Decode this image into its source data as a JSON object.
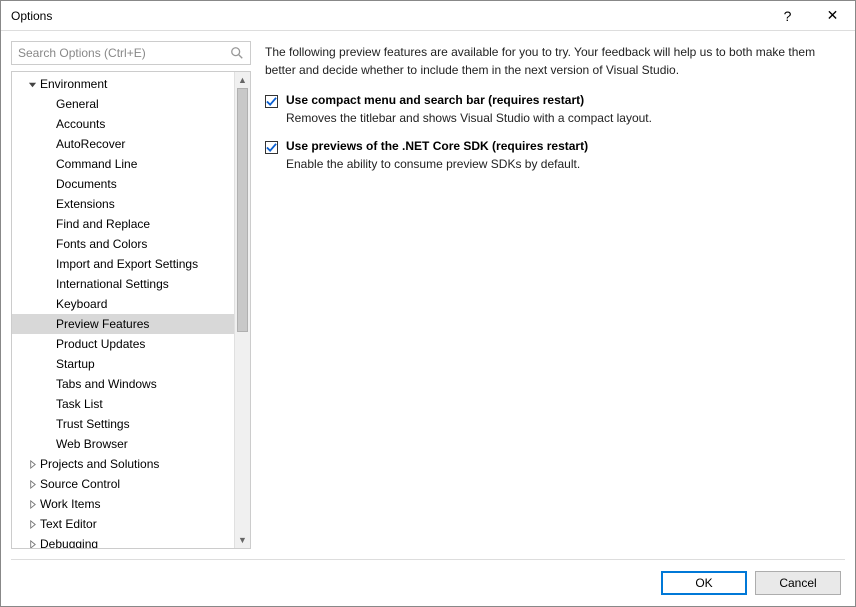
{
  "window": {
    "title": "Options",
    "help_glyph": "?",
    "close_glyph": "✕"
  },
  "search": {
    "placeholder": "Search Options (Ctrl+E)"
  },
  "tree": {
    "groups": [
      {
        "label": "Environment",
        "expanded": true,
        "children": [
          {
            "label": "General"
          },
          {
            "label": "Accounts"
          },
          {
            "label": "AutoRecover"
          },
          {
            "label": "Command Line"
          },
          {
            "label": "Documents"
          },
          {
            "label": "Extensions"
          },
          {
            "label": "Find and Replace"
          },
          {
            "label": "Fonts and Colors"
          },
          {
            "label": "Import and Export Settings"
          },
          {
            "label": "International Settings"
          },
          {
            "label": "Keyboard"
          },
          {
            "label": "Preview Features",
            "selected": true
          },
          {
            "label": "Product Updates"
          },
          {
            "label": "Startup"
          },
          {
            "label": "Tabs and Windows"
          },
          {
            "label": "Task List"
          },
          {
            "label": "Trust Settings"
          },
          {
            "label": "Web Browser"
          }
        ]
      },
      {
        "label": "Projects and Solutions",
        "expanded": false
      },
      {
        "label": "Source Control",
        "expanded": false
      },
      {
        "label": "Work Items",
        "expanded": false
      },
      {
        "label": "Text Editor",
        "expanded": false
      },
      {
        "label": "Debugging",
        "expanded": false
      }
    ]
  },
  "content": {
    "intro": "The following preview features are available for you to try. Your feedback will help us to both make them better and decide whether to include them in the next version of Visual Studio.",
    "options": [
      {
        "checked": true,
        "title": "Use compact menu and search bar (requires restart)",
        "desc": "Removes the titlebar and shows Visual Studio with a compact layout."
      },
      {
        "checked": true,
        "title": "Use previews of the .NET Core SDK (requires restart)",
        "desc": "Enable the ability to consume preview SDKs by default."
      }
    ]
  },
  "footer": {
    "ok": "OK",
    "cancel": "Cancel"
  }
}
